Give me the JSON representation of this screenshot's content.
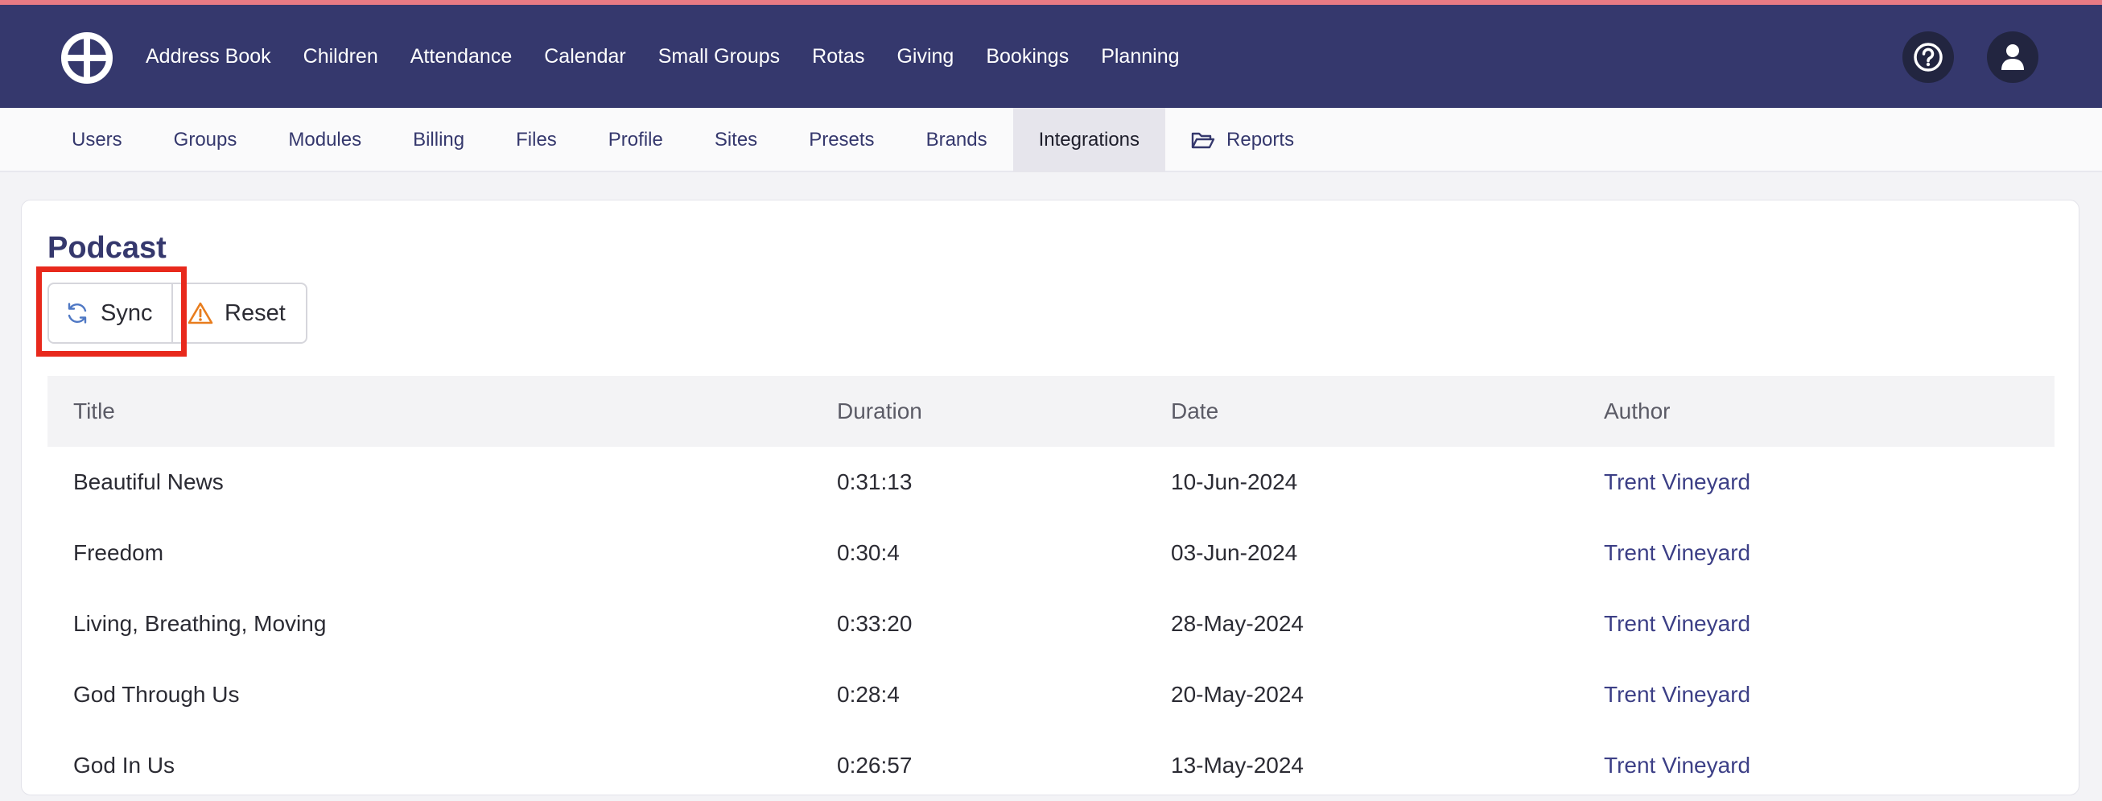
{
  "colors": {
    "accent_bar": "#e87a84",
    "nav_background": "#35386d",
    "highlight": "#e8291c",
    "link": "#3c3f86"
  },
  "topnav": {
    "logo_icon": "cross-circle-logo",
    "links": [
      "Address Book",
      "Children",
      "Attendance",
      "Calendar",
      "Small Groups",
      "Rotas",
      "Giving",
      "Bookings",
      "Planning"
    ],
    "help_icon": "question-circle-icon",
    "user_icon": "user-icon"
  },
  "subnav": {
    "tabs": [
      "Users",
      "Groups",
      "Modules",
      "Billing",
      "Files",
      "Profile",
      "Sites",
      "Presets",
      "Brands",
      "Integrations",
      "Reports"
    ],
    "active_tab": "Integrations",
    "reports_icon": "folder-open-icon"
  },
  "card": {
    "title": "Podcast",
    "sync_label": "Sync",
    "sync_icon": "sync-icon",
    "reset_label": "Reset",
    "reset_icon": "warning-icon"
  },
  "table": {
    "headers": [
      "Title",
      "Duration",
      "Date",
      "Author"
    ],
    "rows": [
      {
        "title": "Beautiful News",
        "duration": "0:31:13",
        "date": "10-Jun-2024",
        "author": "Trent Vineyard"
      },
      {
        "title": "Freedom",
        "duration": "0:30:4",
        "date": "03-Jun-2024",
        "author": "Trent Vineyard"
      },
      {
        "title": "Living, Breathing, Moving",
        "duration": "0:33:20",
        "date": "28-May-2024",
        "author": "Trent Vineyard"
      },
      {
        "title": "God Through Us",
        "duration": "0:28:4",
        "date": "20-May-2024",
        "author": "Trent Vineyard"
      },
      {
        "title": "God In Us",
        "duration": "0:26:57",
        "date": "13-May-2024",
        "author": "Trent Vineyard"
      }
    ]
  }
}
